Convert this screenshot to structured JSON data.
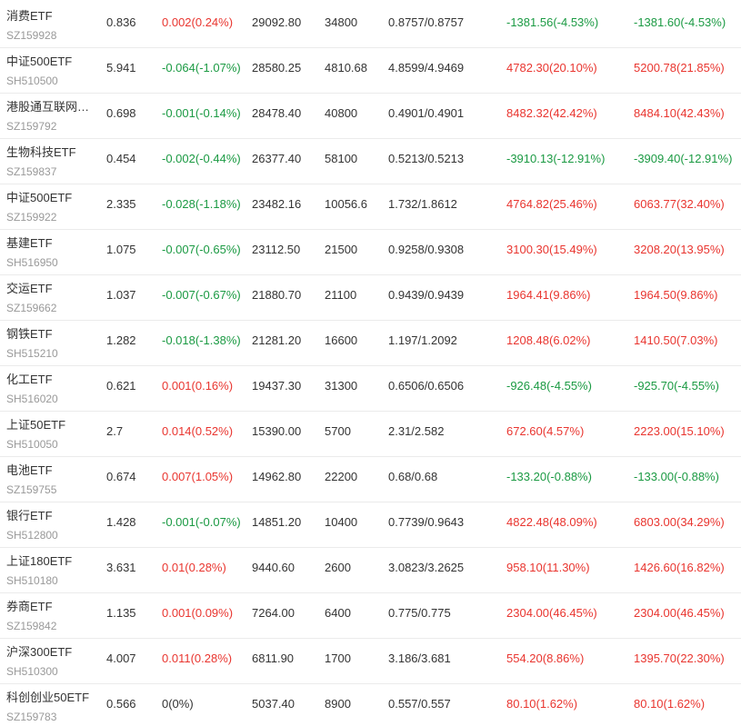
{
  "colors": {
    "up": "#e9352f",
    "down": "#1b9a43",
    "flat": "#333333",
    "text": "#333333",
    "secondary": "#999999",
    "divider": "#ebebeb"
  },
  "rows": [
    {
      "name": "消费ETF",
      "code": "SZ159928",
      "price": "0.836",
      "change": "0.002(0.24%)",
      "amount": "29092.80",
      "quantity": "34800",
      "cost": "0.8757/0.8757",
      "profit": "-1381.56(-4.53%)",
      "total_profit": "-1381.60(-4.53%)"
    },
    {
      "name": "中证500ETF",
      "code": "SH510500",
      "price": "5.941",
      "change": "-0.064(-1.07%)",
      "amount": "28580.25",
      "quantity": "4810.68",
      "cost": "4.8599/4.9469",
      "profit": "4782.30(20.10%)",
      "total_profit": "5200.78(21.85%)"
    },
    {
      "name": "港股通互联网…",
      "code": "SZ159792",
      "price": "0.698",
      "change": "-0.001(-0.14%)",
      "amount": "28478.40",
      "quantity": "40800",
      "cost": "0.4901/0.4901",
      "profit": "8482.32(42.42%)",
      "total_profit": "8484.10(42.43%)"
    },
    {
      "name": "生物科技ETF",
      "code": "SZ159837",
      "price": "0.454",
      "change": "-0.002(-0.44%)",
      "amount": "26377.40",
      "quantity": "58100",
      "cost": "0.5213/0.5213",
      "profit": "-3910.13(-12.91%)",
      "total_profit": "-3909.40(-12.91%)"
    },
    {
      "name": "中证500ETF",
      "code": "SZ159922",
      "price": "2.335",
      "change": "-0.028(-1.18%)",
      "amount": "23482.16",
      "quantity": "10056.6",
      "cost": "1.732/1.8612",
      "profit": "4764.82(25.46%)",
      "total_profit": "6063.77(32.40%)"
    },
    {
      "name": "基建ETF",
      "code": "SH516950",
      "price": "1.075",
      "change": "-0.007(-0.65%)",
      "amount": "23112.50",
      "quantity": "21500",
      "cost": "0.9258/0.9308",
      "profit": "3100.30(15.49%)",
      "total_profit": "3208.20(13.95%)"
    },
    {
      "name": "交运ETF",
      "code": "SZ159662",
      "price": "1.037",
      "change": "-0.007(-0.67%)",
      "amount": "21880.70",
      "quantity": "21100",
      "cost": "0.9439/0.9439",
      "profit": "1964.41(9.86%)",
      "total_profit": "1964.50(9.86%)"
    },
    {
      "name": "钢铁ETF",
      "code": "SH515210",
      "price": "1.282",
      "change": "-0.018(-1.38%)",
      "amount": "21281.20",
      "quantity": "16600",
      "cost": "1.197/1.2092",
      "profit": "1208.48(6.02%)",
      "total_profit": "1410.50(7.03%)"
    },
    {
      "name": "化工ETF",
      "code": "SH516020",
      "price": "0.621",
      "change": "0.001(0.16%)",
      "amount": "19437.30",
      "quantity": "31300",
      "cost": "0.6506/0.6506",
      "profit": "-926.48(-4.55%)",
      "total_profit": "-925.70(-4.55%)"
    },
    {
      "name": "上证50ETF",
      "code": "SH510050",
      "price": "2.7",
      "change": "0.014(0.52%)",
      "amount": "15390.00",
      "quantity": "5700",
      "cost": "2.31/2.582",
      "profit": "672.60(4.57%)",
      "total_profit": "2223.00(15.10%)"
    },
    {
      "name": "电池ETF",
      "code": "SZ159755",
      "price": "0.674",
      "change": "0.007(1.05%)",
      "amount": "14962.80",
      "quantity": "22200",
      "cost": "0.68/0.68",
      "profit": "-133.20(-0.88%)",
      "total_profit": "-133.00(-0.88%)"
    },
    {
      "name": "银行ETF",
      "code": "SH512800",
      "price": "1.428",
      "change": "-0.001(-0.07%)",
      "amount": "14851.20",
      "quantity": "10400",
      "cost": "0.7739/0.9643",
      "profit": "4822.48(48.09%)",
      "total_profit": "6803.00(34.29%)"
    },
    {
      "name": "上证180ETF",
      "code": "SH510180",
      "price": "3.631",
      "change": "0.01(0.28%)",
      "amount": "9440.60",
      "quantity": "2600",
      "cost": "3.0823/3.2625",
      "profit": "958.10(11.30%)",
      "total_profit": "1426.60(16.82%)"
    },
    {
      "name": "券商ETF",
      "code": "SZ159842",
      "price": "1.135",
      "change": "0.001(0.09%)",
      "amount": "7264.00",
      "quantity": "6400",
      "cost": "0.775/0.775",
      "profit": "2304.00(46.45%)",
      "total_profit": "2304.00(46.45%)"
    },
    {
      "name": "沪深300ETF",
      "code": "SH510300",
      "price": "4.007",
      "change": "0.011(0.28%)",
      "amount": "6811.90",
      "quantity": "1700",
      "cost": "3.186/3.681",
      "profit": "554.20(8.86%)",
      "total_profit": "1395.70(22.30%)"
    },
    {
      "name": "科创创业50ETF",
      "code": "SZ159783",
      "price": "0.566",
      "change": "0(0%)",
      "amount": "5037.40",
      "quantity": "8900",
      "cost": "0.557/0.557",
      "profit": "80.10(1.62%)",
      "total_profit": "80.10(1.62%)"
    }
  ]
}
